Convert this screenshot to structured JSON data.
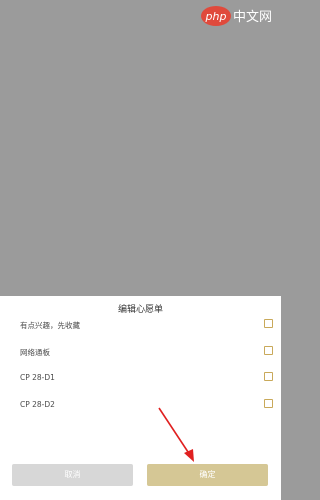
{
  "watermark": {
    "php": "php",
    "site": "中文网"
  },
  "sheet": {
    "title": "编辑心愿单",
    "items": [
      {
        "label": "有点兴趣，先收藏"
      },
      {
        "label": "网络通板"
      },
      {
        "label": "CP 28-D1"
      },
      {
        "label": "CP 28-D2"
      }
    ],
    "cancel_label": "取消",
    "confirm_label": "确定"
  },
  "colors": {
    "accent": "#c9a95a",
    "confirm_bg": "#d5c795",
    "cancel_bg": "#d7d7d7",
    "overlay": "#9b9b9b",
    "annotation_arrow": "#e02020"
  }
}
